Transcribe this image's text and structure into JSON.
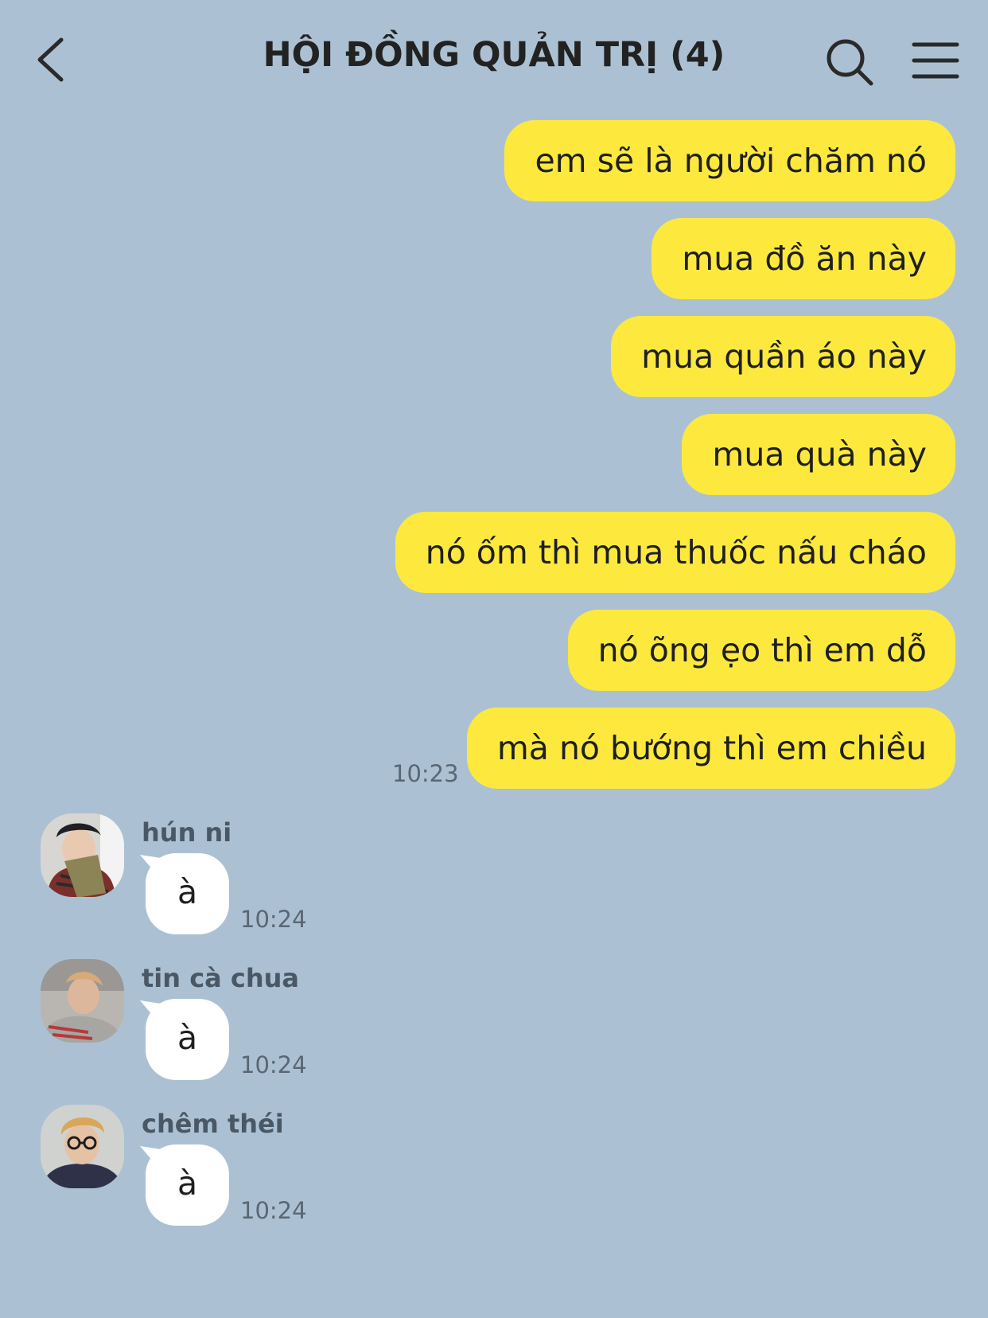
{
  "header": {
    "title": "HỘI ĐỒNG QUẢN TRỊ (4)"
  },
  "outgoing": [
    {
      "text": "em sẽ là người chăm nó"
    },
    {
      "text": "mua đồ ăn này"
    },
    {
      "text": "mua quần áo này"
    },
    {
      "text": "mua quà này"
    },
    {
      "text": "nó ốm thì mua thuốc nấu cháo"
    },
    {
      "text": "nó õng ẹo thì em dỗ"
    },
    {
      "text": "mà nó bướng thì em chiều",
      "time": "10:23"
    }
  ],
  "incoming": [
    {
      "sender": "hún ni",
      "text": "à",
      "time": "10:24"
    },
    {
      "sender": "tin cà chua",
      "text": "à",
      "time": "10:24"
    },
    {
      "sender": "chêm théi",
      "text": "à",
      "time": "10:24"
    }
  ],
  "colors": {
    "background": "#abc1d3",
    "outgoing_bubble": "#fde93e",
    "incoming_bubble": "#ffffff"
  }
}
